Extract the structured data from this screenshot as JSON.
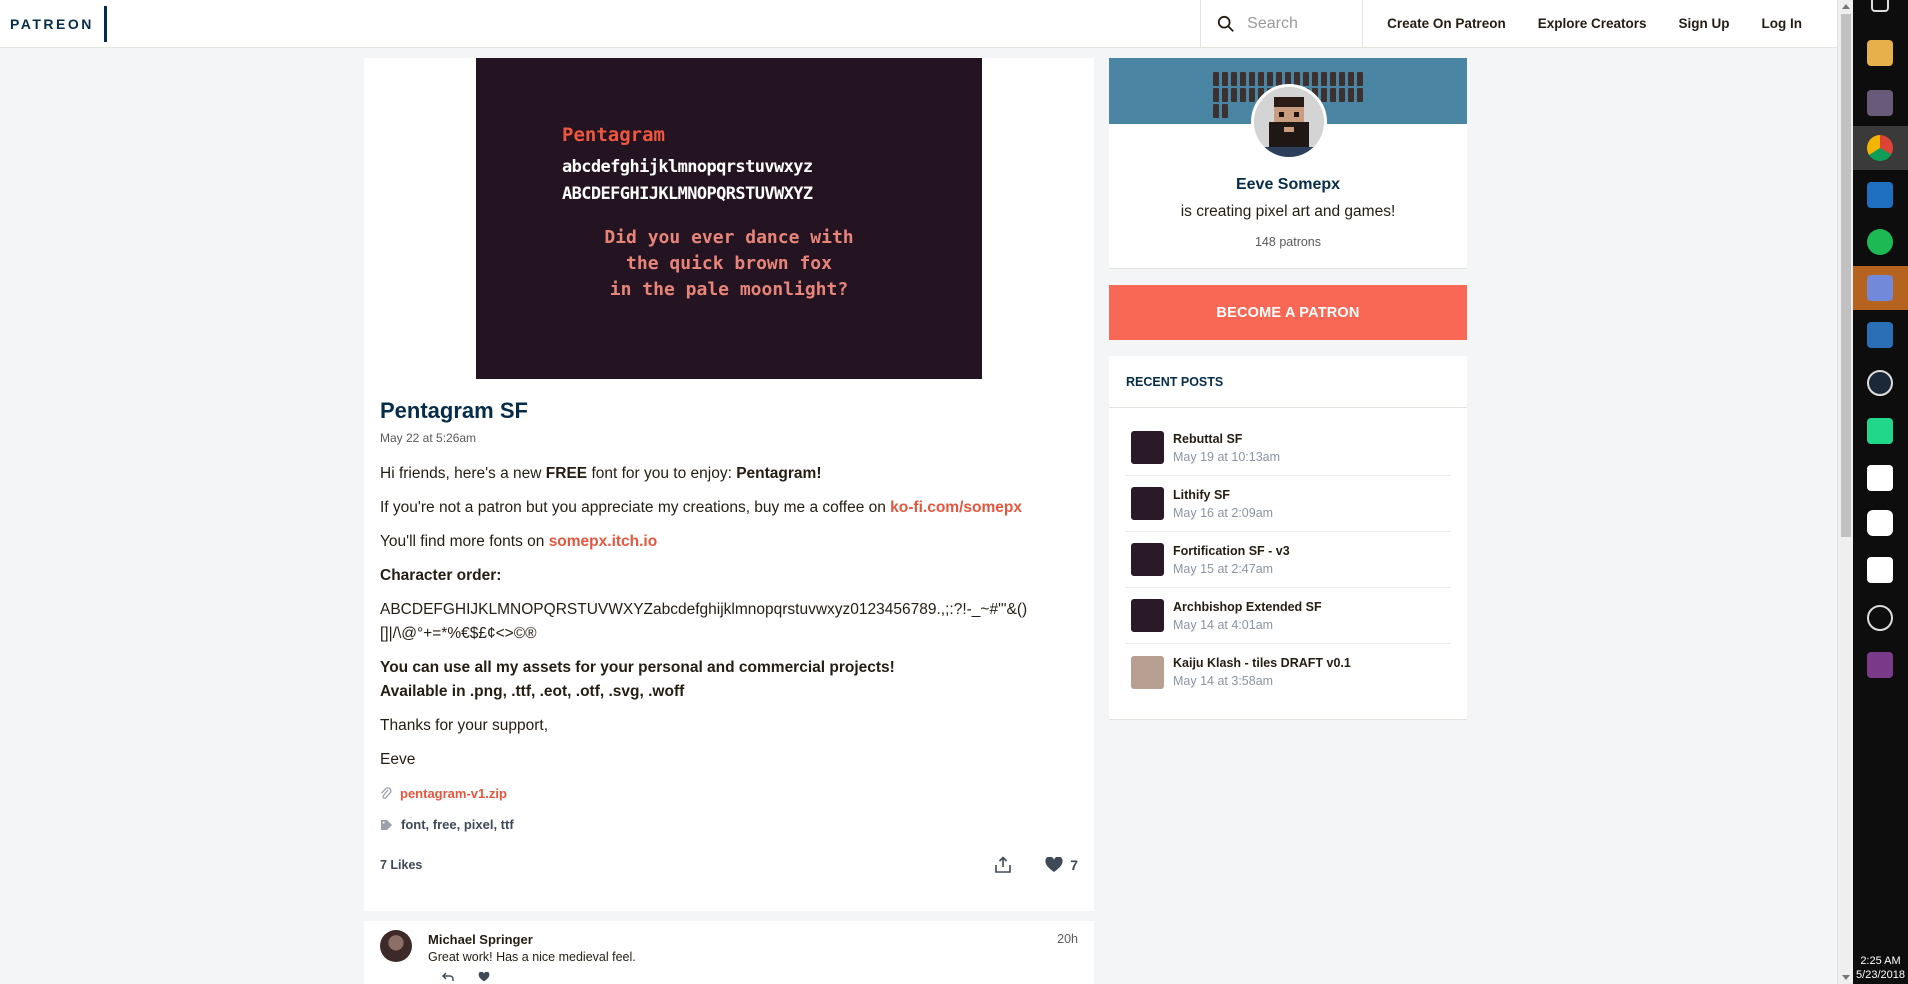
{
  "nav": {
    "logo": "PATREON",
    "search_placeholder": "Search",
    "links": [
      "Create On Patreon",
      "Explore Creators",
      "Sign Up",
      "Log In"
    ]
  },
  "post": {
    "image": {
      "line1": "Pentagram",
      "line2": "abcdefghijklmnopqrstuvwxyz",
      "line3": "ABCDEFGHIJKLMNOPQRSTUVWXYZ",
      "line4": "Did you ever dance with",
      "line5": "the quick brown fox",
      "line6": "in the pale moonlight?"
    },
    "title": "Pentagram SF",
    "date": "May 22 at 5:26am",
    "p1_a": "Hi friends, here's a new ",
    "p1_b": "FREE",
    "p1_c": " font for you to enjoy: ",
    "p1_d": "Pentagram!",
    "p2_a": "If you're not a patron but you appreciate my creations, buy me a coffee on ",
    "p2_link": "ko-fi.com/somepx",
    "p3_a": "You'll find more fonts on ",
    "p3_link": "somepx.itch.io",
    "char_order_label": "Character order:",
    "char_order_1": "ABCDEFGHIJKLMNOPQRSTUVWXYZabcdefghijklmnopqrstuvwxyz0123456789.,;:?!-_~#\"'&()",
    "char_order_2": "[]|/\\@°+=*%€$£¢<>©®",
    "usage_1": "You can use all my assets for your personal and commercial projects!",
    "usage_2": "Available in .png, .ttf, .eot, .otf, .svg, .woff",
    "thanks": "Thanks for your support,",
    "signoff": "Eeve",
    "attachment": "pentagram-v1.zip",
    "tags": "font, free, pixel, ttf",
    "likes_label": "7 Likes",
    "like_count": "7"
  },
  "comment": {
    "author": "Michael Springer",
    "text": "Great work! Has a nice medieval feel.",
    "time": "20h"
  },
  "creator": {
    "name": "Eeve Somepx",
    "tagline": "is creating pixel art and games!",
    "patrons": "148 patrons",
    "cta": "BECOME A PATRON"
  },
  "recent": {
    "header": "RECENT POSTS",
    "items": [
      {
        "title": "Rebuttal SF",
        "date": "May 19 at 10:13am"
      },
      {
        "title": "Lithify SF",
        "date": "May 16 at 2:09am"
      },
      {
        "title": "Fortification SF - v3",
        "date": "May 15 at 2:47am"
      },
      {
        "title": "Archbishop Extended SF",
        "date": "May 14 at 4:01am"
      },
      {
        "title": "Kaiju Klash - tiles DRAFT v0.1",
        "date": "May 14 at 3:58am"
      }
    ]
  },
  "taskbar": {
    "time": "2:25 AM",
    "date": "5/23/2018"
  },
  "colors": {
    "accent": "#f96854",
    "link": "#e4573e",
    "navy": "#052d49"
  }
}
